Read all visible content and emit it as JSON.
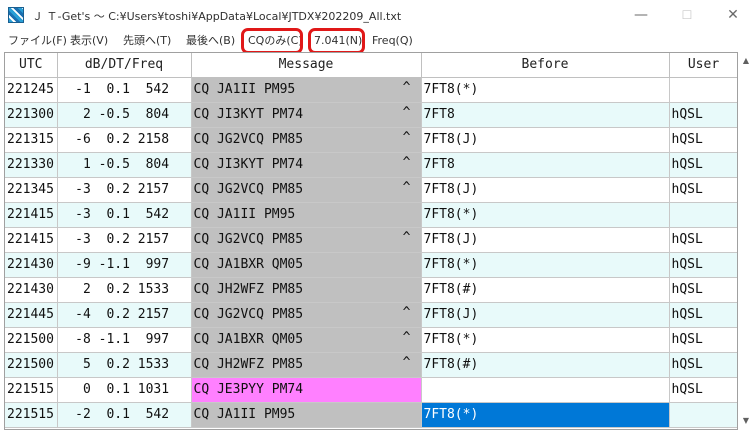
{
  "window": {
    "title": "Ｊ Ｔ-Get's 〜 C:¥Users¥toshi¥AppData¥Local¥JTDX¥202209_All.txt",
    "min_glyph": "—",
    "max_glyph": "☐",
    "close_glyph": "✕"
  },
  "menu": [
    "ファイル(F)",
    "表示(V)",
    "先頭へ(T)",
    "最後へ(B)",
    "CQのみ(C)",
    "7.041(N)",
    "Freq(Q)"
  ],
  "table": {
    "columns": [
      "UTC",
      "dB/DT/Freq",
      "Message",
      "Before",
      "User"
    ],
    "rows": [
      {
        "utc": "221245",
        "db": "  -1  0.1  542",
        "msg": "CQ JA1II PM95",
        "caret": "^",
        "before": "7FT8(*)",
        "user": ""
      },
      {
        "utc": "221300",
        "db": "   2 -0.5  804",
        "msg": "CQ JI3KYT PM74",
        "caret": "^",
        "before": "7FT8",
        "user": "hQSL"
      },
      {
        "utc": "221315",
        "db": "  -6  0.2 2158",
        "msg": "CQ JG2VCQ PM85",
        "caret": "^",
        "before": "7FT8(J)",
        "user": "hQSL"
      },
      {
        "utc": "221330",
        "db": "   1 -0.5  804",
        "msg": "CQ JI3KYT PM74",
        "caret": "^",
        "before": "7FT8",
        "user": "hQSL"
      },
      {
        "utc": "221345",
        "db": "  -3  0.2 2157",
        "msg": "CQ JG2VCQ PM85",
        "caret": "^",
        "before": "7FT8(J)",
        "user": "hQSL"
      },
      {
        "utc": "221415",
        "db": "  -3  0.1  542",
        "msg": "CQ JA1II PM95",
        "caret": "",
        "before": "7FT8(*)",
        "user": ""
      },
      {
        "utc": "221415",
        "db": "  -3  0.2 2157",
        "msg": "CQ JG2VCQ PM85",
        "caret": "^",
        "before": "7FT8(J)",
        "user": "hQSL"
      },
      {
        "utc": "221430",
        "db": "  -9 -1.1  997",
        "msg": "CQ JA1BXR QM05",
        "caret": "",
        "before": "7FT8(*)",
        "user": "hQSL"
      },
      {
        "utc": "221430",
        "db": "   2  0.2 1533",
        "msg": "CQ JH2WFZ PM85",
        "caret": "",
        "before": "7FT8(#)",
        "user": "hQSL"
      },
      {
        "utc": "221445",
        "db": "  -4  0.2 2157",
        "msg": "CQ JG2VCQ PM85",
        "caret": "^",
        "before": "7FT8(J)",
        "user": "hQSL"
      },
      {
        "utc": "221500",
        "db": "  -8 -1.1  997",
        "msg": "CQ JA1BXR QM05",
        "caret": "^",
        "before": "7FT8(*)",
        "user": "hQSL"
      },
      {
        "utc": "221500",
        "db": "   5  0.2 1533",
        "msg": "CQ JH2WFZ PM85",
        "caret": "^",
        "before": "7FT8(#)",
        "user": "hQSL"
      },
      {
        "utc": "221515",
        "db": "   0  0.1 1031",
        "msg": "CQ JE3PYY PM74",
        "caret": "",
        "before": "",
        "user": "hQSL"
      },
      {
        "utc": "221515",
        "db": "  -2  0.1  542",
        "msg": "CQ JA1II PM95",
        "caret": "",
        "before": "7FT8(*)",
        "user": ""
      }
    ]
  },
  "scrollbar": {
    "up_glyph": "▲",
    "down_glyph": "▼"
  },
  "colors": {
    "message_bg": "#c0c0c0",
    "new_station_bg": "#ff80ff",
    "selection_bg": "#0078d7",
    "alt_row_bg": "#e8fafa",
    "highlight_box": "#e01818"
  }
}
